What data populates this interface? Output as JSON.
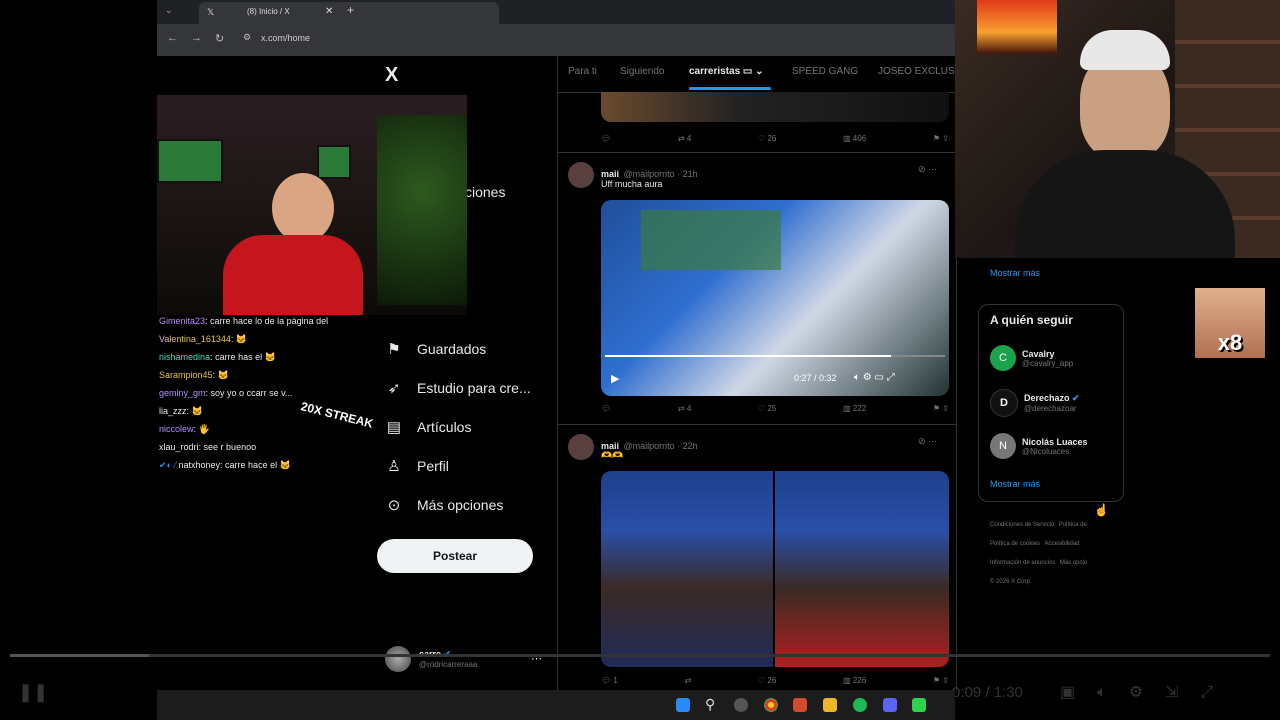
{
  "browser": {
    "tab_title": "(8) Inicio / X",
    "url": "x.com/home"
  },
  "nav": {
    "logo": "X",
    "partial_label": "ciones",
    "items": [
      {
        "label": "Guardados",
        "icon": "bookmark-icon",
        "glyph": "🔖"
      },
      {
        "label": "Estudio para cre...",
        "icon": "rocket-icon",
        "glyph": "🚀"
      },
      {
        "label": "Artículos",
        "icon": "article-icon",
        "glyph": "📝"
      },
      {
        "label": "Perfil",
        "icon": "profile-icon",
        "glyph": "👤"
      },
      {
        "label": "Más opciones",
        "icon": "more-icon",
        "glyph": "⋯"
      }
    ],
    "post_button": "Postear",
    "account": {
      "name": "carre",
      "handle": "@rodricarreraaa"
    }
  },
  "feed": {
    "tabs": [
      "Para ti",
      "Siguiendo",
      "carreristas",
      "SPEED GANG",
      "JOSEO EXCLUSIV"
    ],
    "active_tab": "carreristas",
    "top_actions": {
      "retweets": "4",
      "likes": "26",
      "views": "406"
    },
    "tweets": [
      {
        "name": "maii",
        "handle": "@mailporrito · 21h",
        "text": "Uff mucha aura",
        "video_time": "0:27 / 0:32",
        "actions": {
          "retweets": "4",
          "likes": "25",
          "views": "222"
        }
      },
      {
        "name": "maii",
        "handle": "@mailporrito · 22h",
        "text": "🫶🫶",
        "actions": {
          "replies": "1",
          "likes": "26",
          "views": "226"
        }
      }
    ]
  },
  "sidebar": {
    "show_more_1": "Mostrar más",
    "who_to_follow_title": "A quién seguir",
    "follows": [
      {
        "name": "Cavalry",
        "handle": "@cavalry_app",
        "initial": "C"
      },
      {
        "name": "Derechazo",
        "handle": "@derechazoar",
        "initial": "D"
      },
      {
        "name": "Nicolás Luaces",
        "handle": "@Nicoluaces",
        "initial": "N"
      }
    ],
    "show_more_2": "Mostrar más",
    "footer": [
      "Condiciones de Servicio",
      "Política de",
      "Política de cookies",
      "Accesibilidad",
      "Información de anuncios",
      "Más opcio",
      "© 2026 X Corp."
    ]
  },
  "stream_overlay": {
    "chat": [
      {
        "user": "Gimenita23",
        "msg": "carre hace lo de la página del",
        "color": "#b58cff"
      },
      {
        "user": "Valentina_161344",
        "msg": "🐱",
        "color": "#e6c34a"
      },
      {
        "user": "nishamedina",
        "msg": "carre has el 🐱",
        "color": "#4cd9c0"
      },
      {
        "user": "Sarampion45",
        "msg": "🐱",
        "color": "#e6c34a"
      },
      {
        "user": "geminy_gm",
        "msg": "soy yo o ccarr se v...",
        "color": "#b58cff"
      },
      {
        "user": "lia_zzz",
        "msg": "🐱",
        "color": "#e7e9ea"
      },
      {
        "user": "niccolew",
        "msg": "🖐",
        "color": "#b58cff"
      },
      {
        "user": "xlau_rodri",
        "msg": "see r buenoo",
        "color": "#e7e9ea"
      },
      {
        "user": "natxhoney",
        "msg": "carre hace el 🐱",
        "color": "#e7e9ea"
      }
    ],
    "streak": "20X STREAK",
    "multiplier": "x8",
    "player_time": "0:09 / 1:30"
  }
}
